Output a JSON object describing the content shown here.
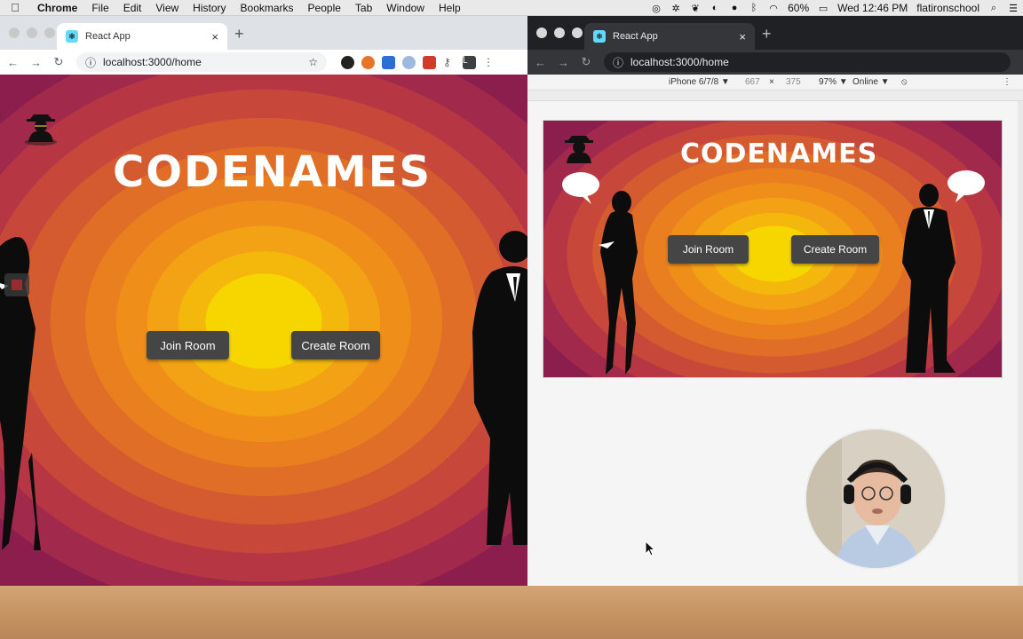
{
  "menubar": {
    "app_name": "Chrome",
    "items": [
      "File",
      "Edit",
      "View",
      "History",
      "Bookmarks",
      "People",
      "Tab",
      "Window",
      "Help"
    ],
    "battery": "60%",
    "clock": "Wed 12:46 PM",
    "user": "flatironschool"
  },
  "left_browser": {
    "tab_title": "React App",
    "url": "localhost:3000/home",
    "profile_initial": "L"
  },
  "right_browser": {
    "tab_title": "React App",
    "url": "localhost:3000/home",
    "device": "iPhone 6/7/8 ▼",
    "width": "667",
    "height": "375",
    "zoom": "97% ▼",
    "network": "Online ▼"
  },
  "app": {
    "title": "CODENAMES",
    "join_label": "Join Room",
    "create_label": "Create Room"
  },
  "colors": {
    "center": "#f7d600",
    "outer": "#8c1e4e",
    "button": "#454545"
  }
}
